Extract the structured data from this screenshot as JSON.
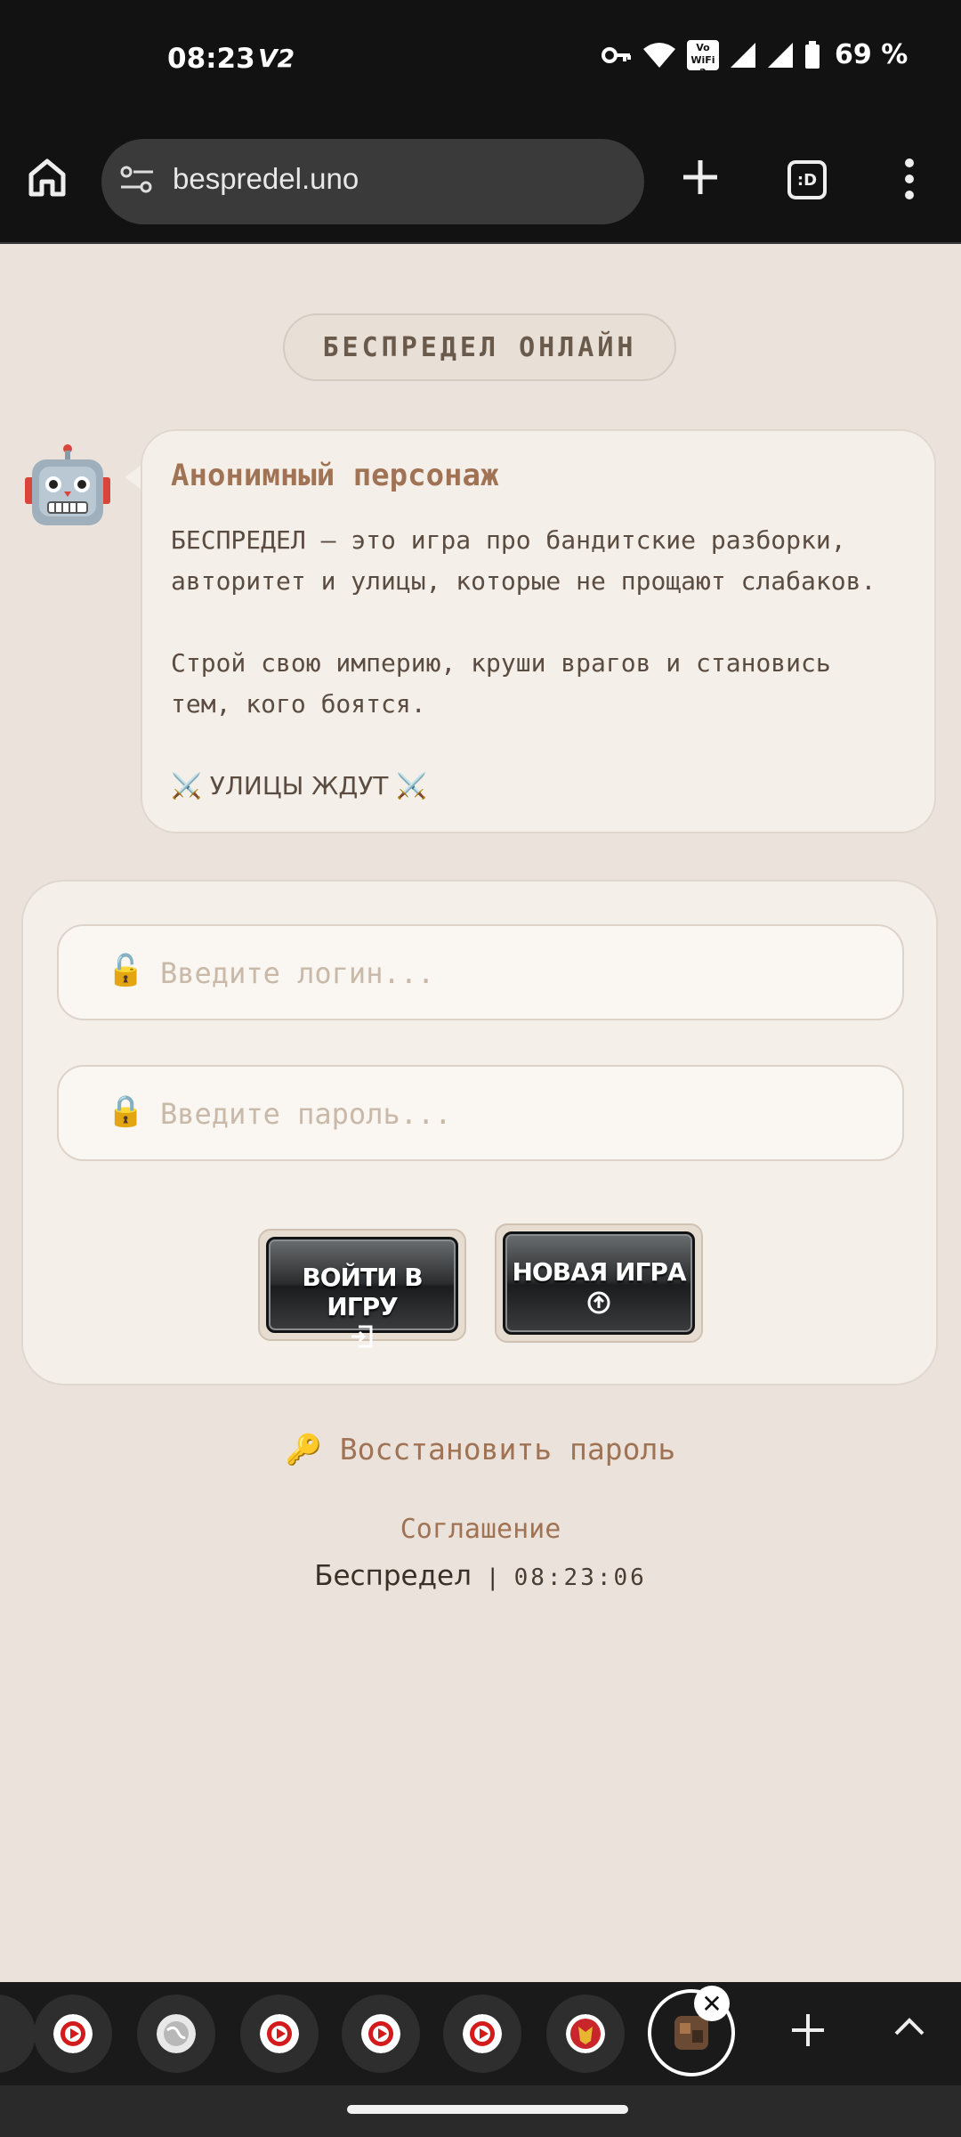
{
  "status_bar": {
    "time": "08:23",
    "carrier": "V2",
    "volte_wifi": "Vo WiFi",
    "wifi_sub": "2",
    "battery": "69 %"
  },
  "browser": {
    "url": "bespredel.uno",
    "tab_switcher_label": ":D"
  },
  "page": {
    "title_pill": "БЕСПРЕДЕЛ ОНЛАЙН",
    "bubble": {
      "name": "Анонимный персонаж",
      "text_line1": "БЕСПРЕДЕЛ – это игра про бандитские разборки,",
      "text_line2": "авторитет и улицы, которые не прощают слабаков.",
      "text_line3": "Строй свою империю, круши врагов и становись",
      "text_line4": "тем, кого боятся.",
      "tagline": "⚔️ УЛИЦЫ ЖДУТ ⚔️"
    },
    "login": {
      "login_placeholder": "Введите логин...",
      "password_placeholder": "Введите пароль...",
      "login_icon": "🔓",
      "password_icon": "🔒",
      "enter_button": "ВОЙТИ В ИГРУ",
      "new_game_button": "НОВАЯ ИГРА"
    },
    "recover_password": "🔑 Восстановить пароль",
    "agreement": "Соглашение",
    "footer": {
      "site": "Беспредел",
      "separator": "|",
      "clock": "08:23:06"
    }
  }
}
